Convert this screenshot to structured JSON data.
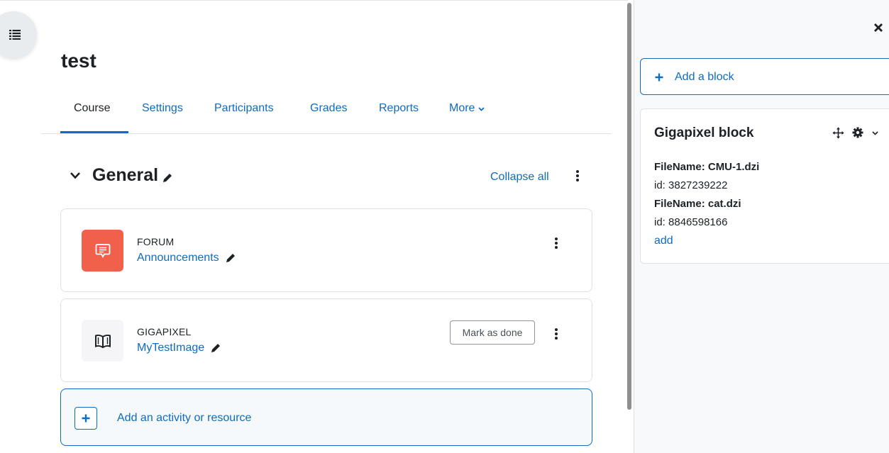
{
  "page": {
    "title": "test"
  },
  "tabs": [
    {
      "label": "Course",
      "active": true
    },
    {
      "label": "Settings"
    },
    {
      "label": "Participants"
    },
    {
      "label": "Grades"
    },
    {
      "label": "Reports"
    },
    {
      "label": "More"
    }
  ],
  "section": {
    "title": "General",
    "collapse_all": "Collapse all"
  },
  "activities": [
    {
      "type": "FORUM",
      "name": "Announcements",
      "icon": "forum-icon",
      "icon_bg": "#f0604a"
    },
    {
      "type": "GIGAPIXEL",
      "name": "MyTestImage",
      "icon": "book-open-icon",
      "icon_bg": "#f5f5f7",
      "completion_label": "Mark as done"
    }
  ],
  "add_activity": {
    "label": "Add an activity or resource"
  },
  "drawer": {
    "add_block": "Add a block",
    "block": {
      "title": "Gigapixel block",
      "entries": [
        {
          "filename": "FileName: CMU-1.dzi",
          "id": "id: 3827239222"
        },
        {
          "filename": "FileName: cat.dzi",
          "id": "id: 8846598166"
        }
      ],
      "add_link": "add"
    }
  },
  "colors": {
    "link": "#0f6cbf",
    "text": "#1d2125",
    "forum_icon_bg": "#f0604a",
    "drawer_bg": "#f8f9fa"
  }
}
